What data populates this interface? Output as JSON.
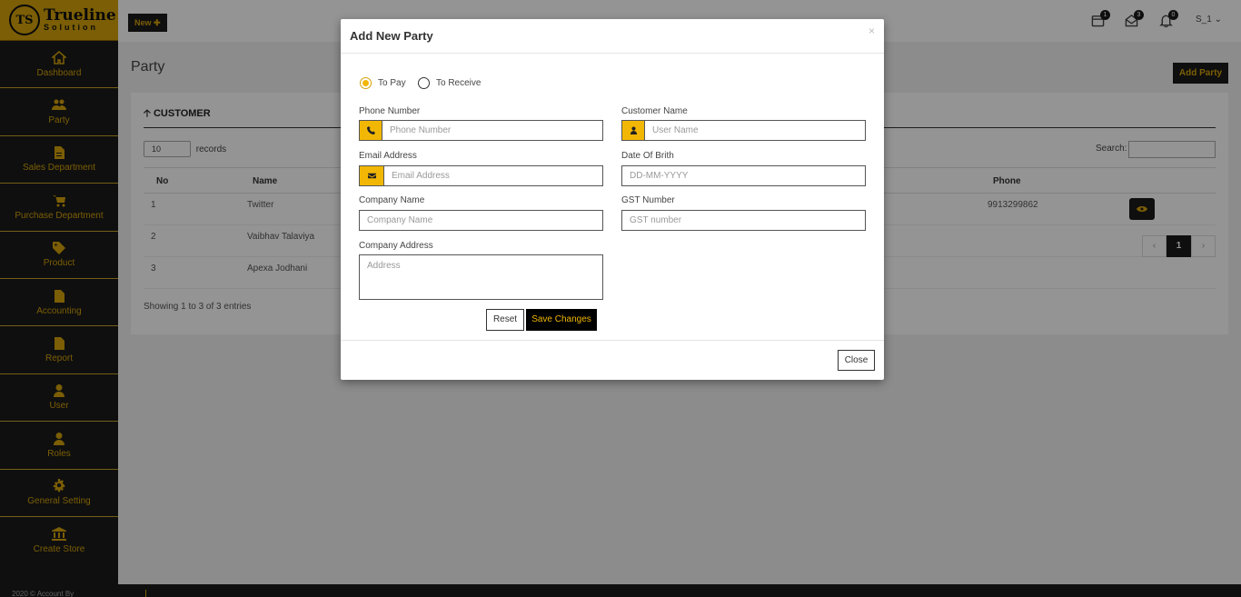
{
  "brand": {
    "badge": "TS",
    "name": "Trueline",
    "sub": "Solution"
  },
  "sidebar": {
    "items": [
      {
        "label": "Dashboard",
        "icon": "home-icon"
      },
      {
        "label": "Party",
        "icon": "users-icon"
      },
      {
        "label": "Sales Department",
        "icon": "file-icon"
      },
      {
        "label": "Purchase Department",
        "icon": "cart-icon"
      },
      {
        "label": "Product",
        "icon": "tag-icon"
      },
      {
        "label": "Accounting",
        "icon": "file-icon"
      },
      {
        "label": "Report",
        "icon": "file-icon"
      },
      {
        "label": "User",
        "icon": "user-icon"
      },
      {
        "label": "Roles",
        "icon": "user-icon"
      },
      {
        "label": "General Setting",
        "icon": "gear-icon"
      },
      {
        "label": "Create Store",
        "icon": "bank-icon"
      }
    ],
    "footer": "2020 © Account By"
  },
  "topbar": {
    "new_label": "New ✚",
    "badges": {
      "calendar": "1",
      "mail": "3",
      "bell": "0"
    },
    "user": "S_1 ⌄"
  },
  "page": {
    "title": "Party",
    "add_button": "Add Party"
  },
  "card": {
    "heading": "CUSTOMER",
    "records_select": "10",
    "records_label": "records",
    "search_label": "Search:",
    "columns": [
      "No",
      "Name",
      "Phone"
    ],
    "rows": [
      {
        "no": "1",
        "name": "Twitter",
        "phone": "9913299862"
      },
      {
        "no": "2",
        "name": "Vaibhav Talaviya",
        "phone": ""
      },
      {
        "no": "3",
        "name": "Apexa Jodhani",
        "phone": ""
      }
    ],
    "pager": {
      "prev": "‹",
      "current": "1",
      "next": "›"
    },
    "showing": "Showing 1 to 3 of 3 entries"
  },
  "modal": {
    "title": "Add New Party",
    "close_x": "×",
    "radio_pay": "To Pay",
    "radio_receive": "To Receive",
    "phone_label": "Phone Number",
    "phone_placeholder": "Phone Number",
    "customer_label": "Customer Name",
    "customer_placeholder": "User Name",
    "email_label": "Email Address",
    "email_placeholder": "Email Address",
    "dob_label": "Date Of Brith",
    "dob_placeholder": "DD-MM-YYYY",
    "company_label": "Company Name",
    "company_placeholder": "Company Name",
    "gst_label": "GST Number",
    "gst_placeholder": "GST number",
    "address_label": "Company Address",
    "address_placeholder": "Address",
    "reset": "Reset",
    "save": "Save Changes",
    "close": "Close"
  },
  "colors": {
    "accent": "#f2b705",
    "dark": "#1a1a1a"
  }
}
